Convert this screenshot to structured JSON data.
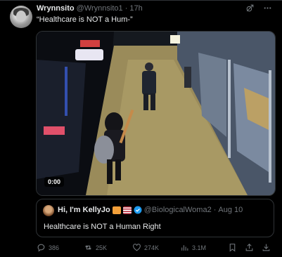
{
  "tweet": {
    "author_name": "Wrynnsito",
    "author_handle": "@Wrynnsito1",
    "separator": "·",
    "time": "17h",
    "text": "“Healthcare is NOT a Hum-”"
  },
  "media": {
    "timer": "0:00"
  },
  "quote": {
    "author_name": "Hi, I'm KellyJo",
    "author_handle": "@BiologicalWoma2",
    "separator": "·",
    "date": "Aug 10",
    "text": "Healthcare is NOT a Human Right"
  },
  "actions": {
    "replies": "386",
    "retweets": "25K",
    "likes": "274K",
    "views": "3.1M"
  },
  "icons": {
    "grok": "grok-icon",
    "more": "more-icon",
    "reply": "reply-icon",
    "retweet": "retweet-icon",
    "like": "like-icon",
    "views": "views-icon",
    "bookmark": "bookmark-icon",
    "share": "share-icon"
  },
  "colors": {
    "background": "#000000",
    "text": "#e7e9ea",
    "muted": "#71767b",
    "border": "#2f3336",
    "verified": "#1d9bf0"
  }
}
